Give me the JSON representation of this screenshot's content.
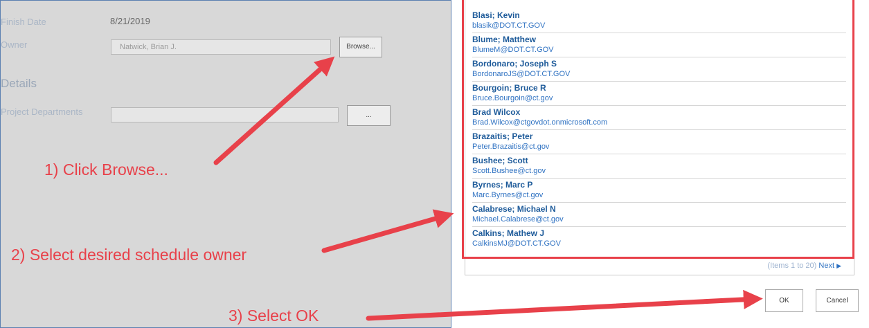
{
  "form": {
    "finish_date_label": "Finish Date",
    "finish_date_value": "8/21/2019",
    "owner_label": "Owner",
    "owner_value": "Natwick, Brian J.",
    "browse_label": "Browse...",
    "details_heading": "Details",
    "departments_label": "Project Departments",
    "departments_value": "",
    "ellipsis_label": "..."
  },
  "people": [
    {
      "name": "Blasi; Kevin",
      "email": "blasik@DOT.CT.GOV"
    },
    {
      "name": "Blume; Matthew",
      "email": "BlumeM@DOT.CT.GOV"
    },
    {
      "name": "Bordonaro; Joseph S",
      "email": "BordonaroJS@DOT.CT.GOV"
    },
    {
      "name": "Bourgoin; Bruce R",
      "email": "Bruce.Bourgoin@ct.gov"
    },
    {
      "name": "Brad Wilcox",
      "email": "Brad.Wilcox@ctgovdot.onmicrosoft.com"
    },
    {
      "name": "Brazaitis; Peter",
      "email": "Peter.Brazaitis@ct.gov"
    },
    {
      "name": "Bushee; Scott",
      "email": "Scott.Bushee@ct.gov"
    },
    {
      "name": "Byrnes; Marc P",
      "email": "Marc.Byrnes@ct.gov"
    },
    {
      "name": "Calabrese; Michael N",
      "email": "Michael.Calabrese@ct.gov"
    },
    {
      "name": "Calkins; Mathew J",
      "email": "CalkinsMJ@DOT.CT.GOV"
    }
  ],
  "pager": {
    "range": "(Items 1 to 20)",
    "next": "Next"
  },
  "dialog": {
    "ok_label": "OK",
    "cancel_label": "Cancel"
  },
  "annotations": {
    "step1": "1) Click Browse...",
    "step2": "2) Select desired schedule owner",
    "step3": "3) Select OK",
    "color": "#e8414a"
  },
  "colors": {
    "name_text": "#1e5b9a",
    "email_text": "#2f72c2",
    "dim_background": "#d8d8d8"
  }
}
